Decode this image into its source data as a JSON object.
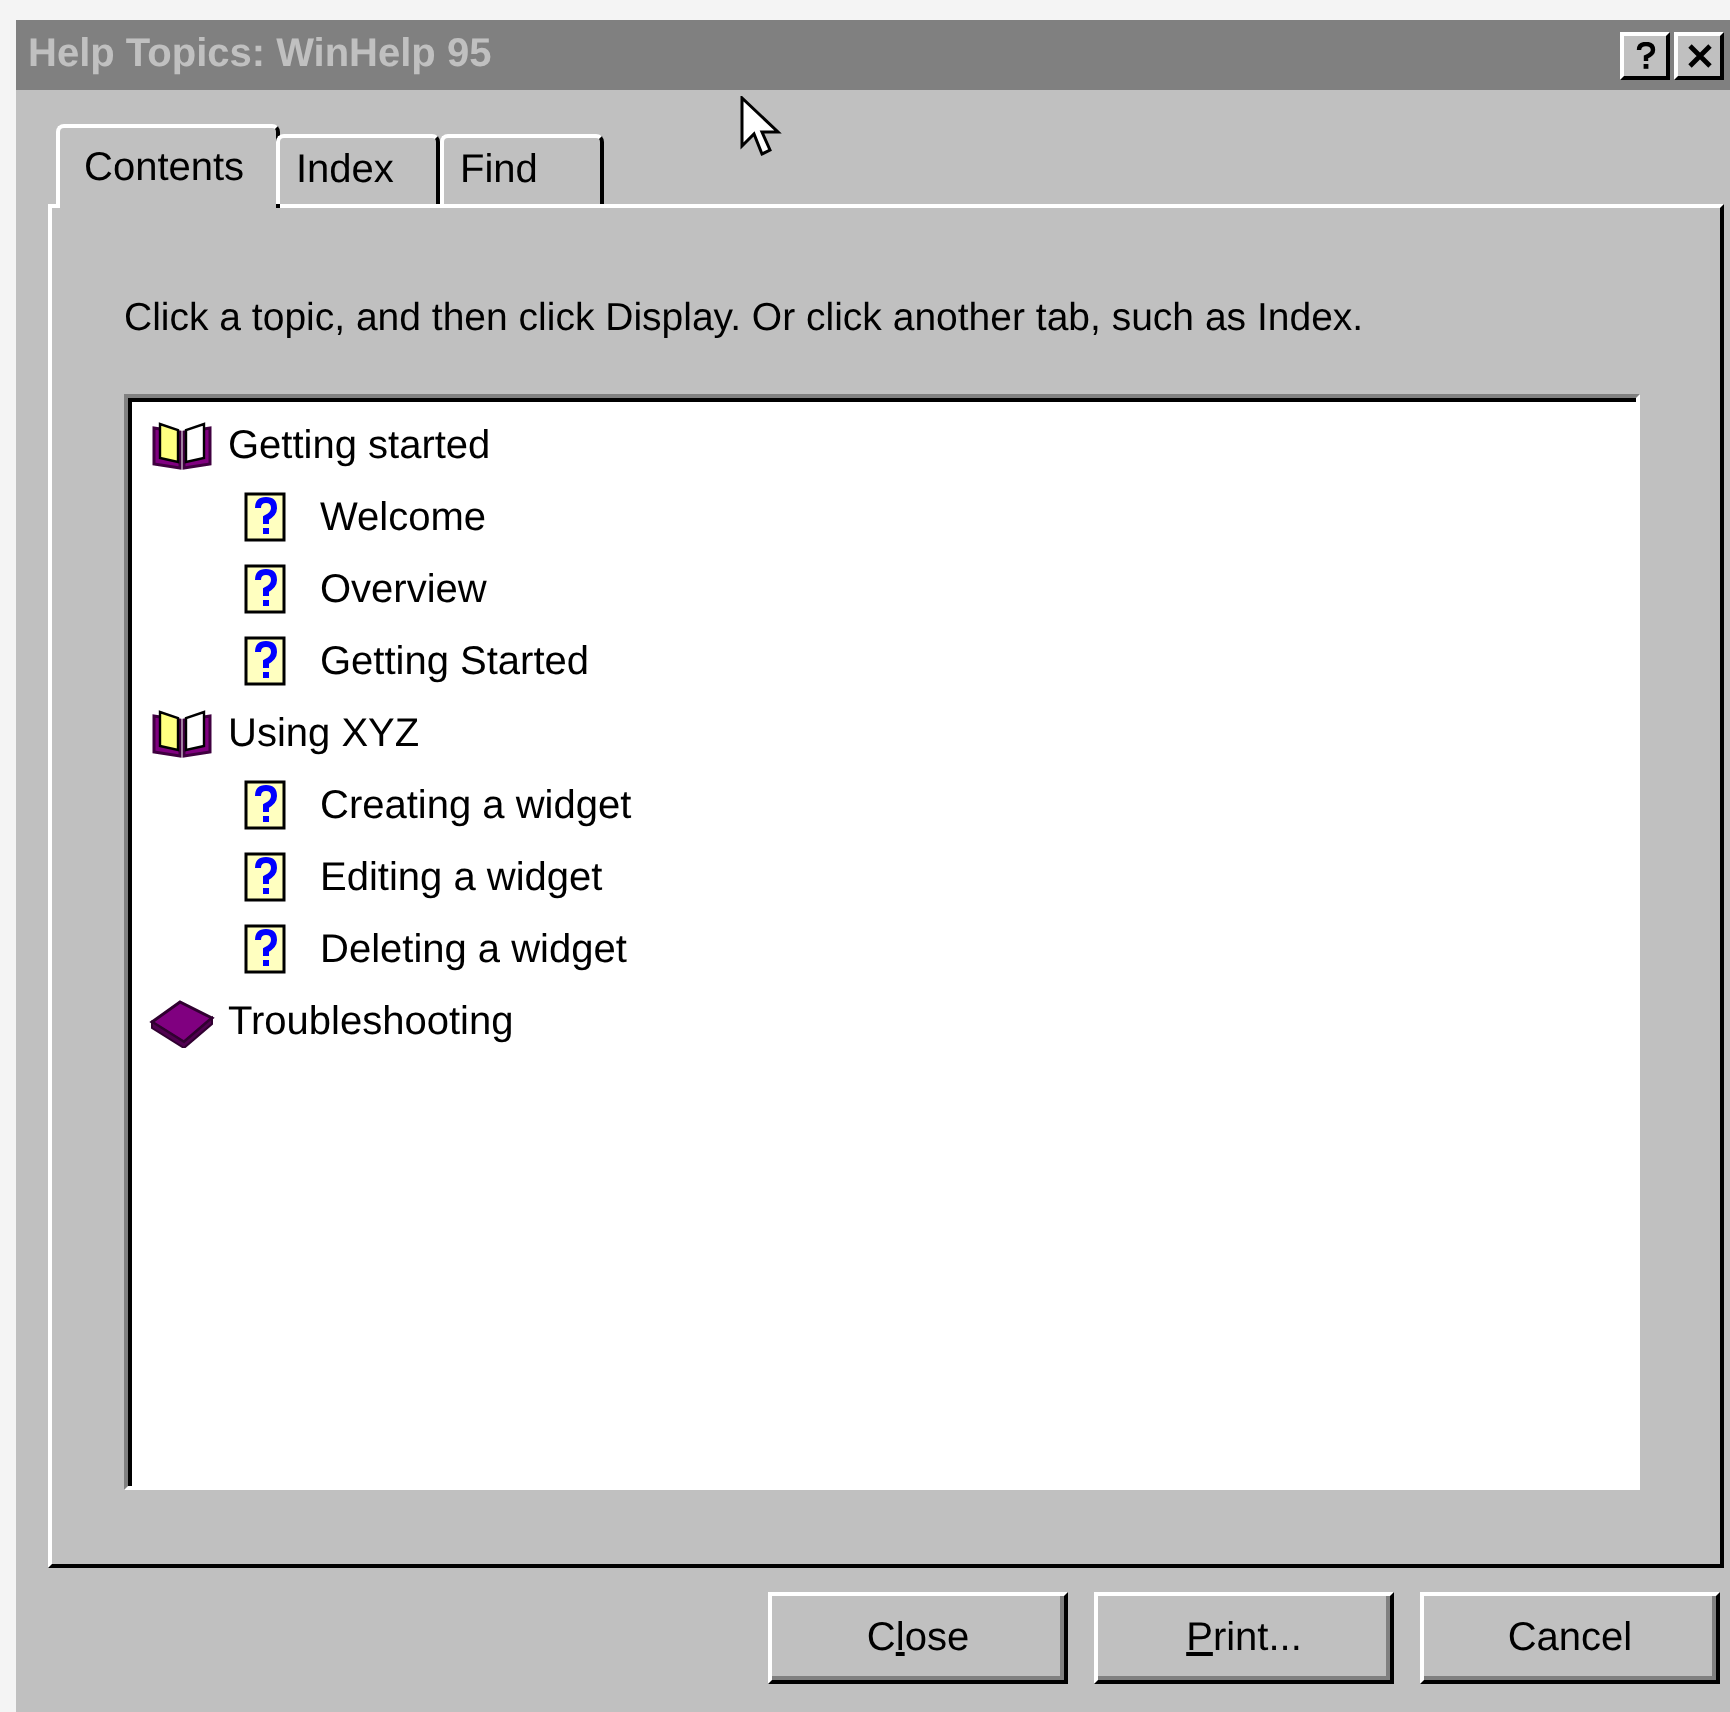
{
  "window": {
    "title": "Help Topics: WinHelp 95"
  },
  "tabs": [
    {
      "label": "Contents",
      "selected": true
    },
    {
      "label": "Index",
      "selected": false
    },
    {
      "label": "Find",
      "selected": false
    }
  ],
  "instructions": "Click a topic, and then click Display. Or click another tab, such as Index.",
  "tree": [
    {
      "label": "Getting started",
      "kind": "book",
      "expanded": true,
      "children": [
        {
          "label": "Welcome",
          "kind": "topic"
        },
        {
          "label": "Overview",
          "kind": "topic"
        },
        {
          "label": "Getting Started",
          "kind": "topic"
        }
      ]
    },
    {
      "label": "Using XYZ",
      "kind": "book",
      "expanded": true,
      "children": [
        {
          "label": "Creating a widget",
          "kind": "topic"
        },
        {
          "label": "Editing a widget",
          "kind": "topic"
        },
        {
          "label": "Deleting a widget",
          "kind": "topic"
        }
      ]
    },
    {
      "label": "Troubleshooting",
      "kind": "book",
      "expanded": false
    }
  ],
  "buttons": [
    {
      "pre": "C",
      "key": "l",
      "post": "ose"
    },
    {
      "key": "P",
      "post": "rint..."
    },
    {
      "pre": "Cancel"
    }
  ]
}
